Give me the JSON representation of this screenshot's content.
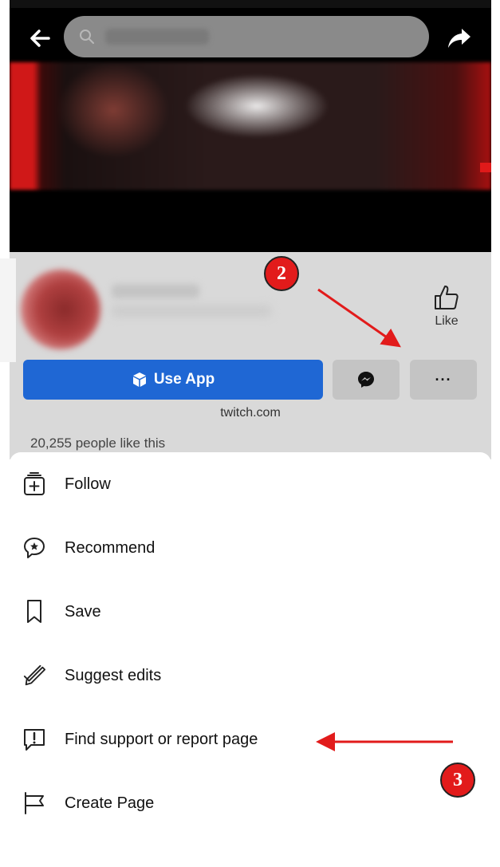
{
  "header": {
    "back_icon": "arrow-left-icon",
    "search_icon": "search-icon",
    "share_icon": "share-arrow-icon"
  },
  "page": {
    "like_label": "Like",
    "use_app_label": "Use App",
    "website": "twitch.com",
    "likes_text": "20,255 people like this",
    "more_label": "···"
  },
  "menu": {
    "items": [
      {
        "label": "Follow",
        "icon": "follow-icon"
      },
      {
        "label": "Recommend",
        "icon": "recommend-icon"
      },
      {
        "label": "Save",
        "icon": "bookmark-icon"
      },
      {
        "label": "Suggest edits",
        "icon": "pencil-icon"
      },
      {
        "label": "Find support or report page",
        "icon": "report-icon"
      },
      {
        "label": "Create Page",
        "icon": "flag-icon"
      }
    ]
  },
  "annotations": {
    "step2": "2",
    "step3": "3"
  },
  "colors": {
    "accent_blue": "#1f67d4",
    "annotation_red": "#e21b1b"
  }
}
